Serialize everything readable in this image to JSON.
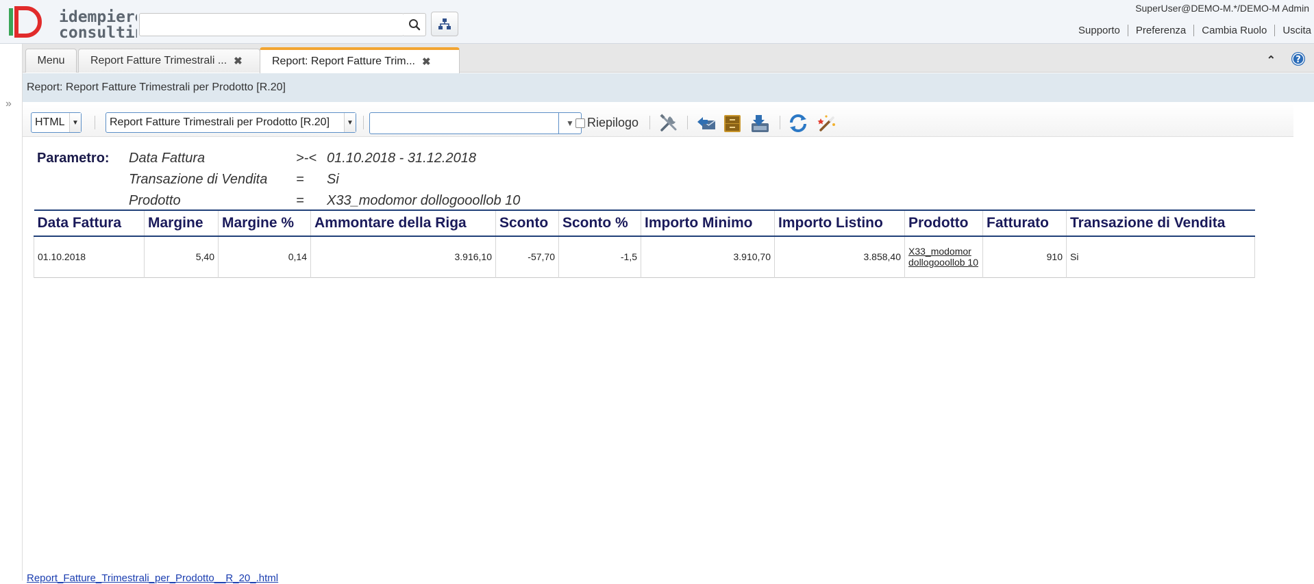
{
  "header": {
    "logo_text_top": "idempiere",
    "logo_text_bottom": "consulting",
    "search_placeholder": "",
    "user": "SuperUser@DEMO-M.*/DEMO-M Admin",
    "links": [
      "Supporto",
      "Preferenza",
      "Cambia Ruolo",
      "Uscita"
    ]
  },
  "tabs": [
    {
      "label": "Menu",
      "closable": false,
      "active": false
    },
    {
      "label": "Report Fatture Trimestrali ...",
      "closable": true,
      "active": false
    },
    {
      "label": "Report: Report Fatture Trim...",
      "closable": true,
      "active": true
    }
  ],
  "title": "Report: Report Fatture Trimestrali per Prodotto [R.20]",
  "toolbar": {
    "format": "HTML",
    "report": "Report Fatture Trimestrali per Prodotto [R.20]",
    "print_format": "",
    "summary_label": "Riepilogo",
    "summary_checked": false,
    "icons": [
      "customize-icon",
      "send-icon",
      "archive-icon",
      "export-icon",
      "refresh-icon",
      "wizard-icon"
    ]
  },
  "parameters": {
    "label": "Parametro:",
    "rows": [
      {
        "name": "Data Fattura",
        "op": ">-<",
        "value": "01.10.2018 - 31.12.2018"
      },
      {
        "name": "Transazione di Vendita",
        "op": "=",
        "value": "Si"
      },
      {
        "name": "Prodotto",
        "op": "=",
        "value": "X33_modomor dollogooollob 10"
      }
    ]
  },
  "table": {
    "columns": [
      "Data Fattura",
      "Margine",
      "Margine %",
      "Ammontare della Riga",
      "Sconto",
      "Sconto %",
      "Importo Minimo",
      "Importo Listino",
      "Prodotto",
      "Fatturato",
      "Transazione di Vendita"
    ],
    "rows": [
      [
        "01.10.2018",
        "5,40",
        "0,14",
        "3.916,10",
        "-57,70",
        "-1,5",
        "3.910,70",
        "3.858,40",
        "X33_modomor dollogooollob 10",
        "910",
        "Si"
      ]
    ]
  },
  "footer_link": "Report_Fatture_Trimestrali_per_Prodotto__R_20_.html",
  "colors": {
    "accent_tab": "#f2a532",
    "header_bg": "#f2f5f9",
    "title_bar": "#dfe8ef",
    "table_header_text": "#1a1a5a"
  }
}
